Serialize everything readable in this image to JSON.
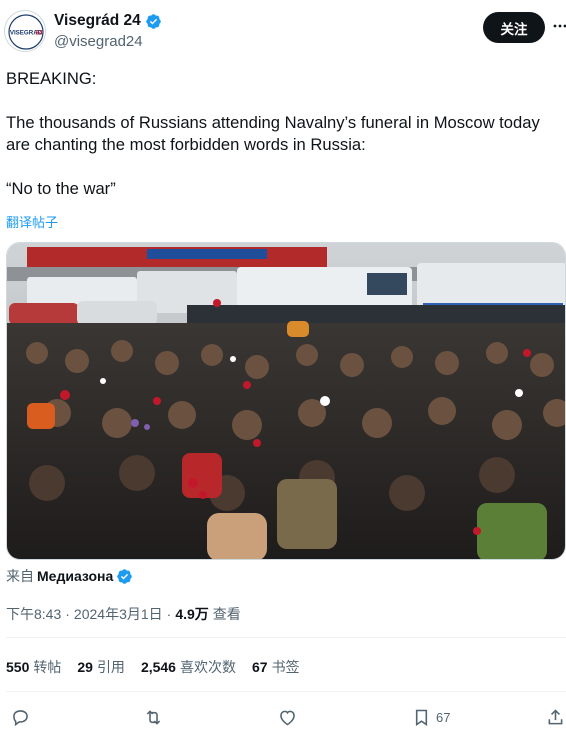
{
  "author": {
    "display_name": "Visegrád 24",
    "handle": "@visegrad24",
    "avatar_text": "VISEGRAD 24",
    "verified": true
  },
  "follow_label": "关注",
  "tweet": {
    "line1": "BREAKING:",
    "line2a": "The thousands of Russians attending Navalny’s funeral in Moscow today",
    "line2b": "are chanting the most forbidden words in Russia:",
    "line3": "“No to the war”"
  },
  "translate_label": "翻译帖子",
  "source": {
    "prefix": "来自",
    "name": "Медиазона"
  },
  "meta": {
    "time": "下午8:43",
    "date": "2024年3月1日",
    "views_count": "4.9万",
    "views_label": "查看",
    "separator": "·"
  },
  "stats": [
    {
      "count": "550",
      "label": "转帖"
    },
    {
      "count": "29",
      "label": "引用"
    },
    {
      "count": "2,546",
      "label": "喜欢次数"
    },
    {
      "count": "67",
      "label": "书签"
    }
  ],
  "actions": {
    "reply": "reply-icon",
    "retweet": "retweet-icon",
    "like": "heart-icon",
    "bookmark": "bookmark-icon",
    "bookmark_count": "67",
    "share": "share-icon"
  },
  "colors": {
    "accent": "#1d9bf0",
    "text": "#0f1419",
    "muted": "#536471",
    "follow_bg": "#0f1419"
  }
}
